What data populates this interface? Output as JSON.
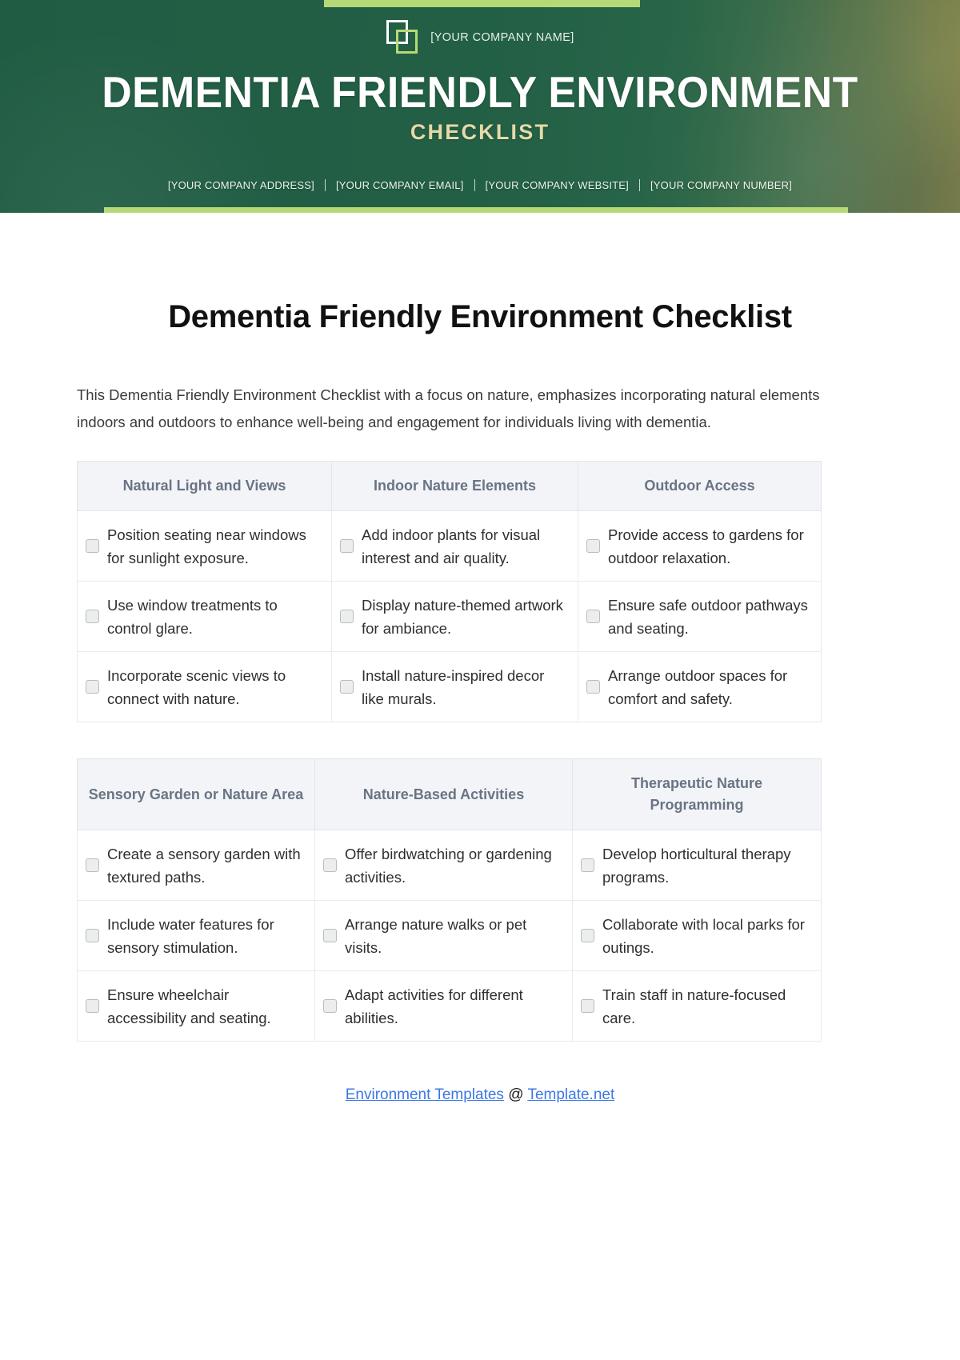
{
  "header": {
    "company_name": "[YOUR COMPANY NAME]",
    "title": "DEMENTIA FRIENDLY ENVIRONMENT",
    "subtitle": "CHECKLIST",
    "contacts": [
      "[YOUR COMPANY ADDRESS]",
      "[YOUR COMPANY EMAIL]",
      "[YOUR COMPANY WEBSITE]",
      "[YOUR COMPANY NUMBER]"
    ],
    "logo_icon": "overlapping-squares-logo",
    "accent_color": "#b6d977",
    "bg_color": "#2b6a4b",
    "subtitle_color": "#e6d9a8"
  },
  "document": {
    "title": "Dementia Friendly Environment Checklist",
    "intro": "This Dementia Friendly Environment Checklist with a focus on nature, emphasizes incorporating natural elements indoors and outdoors to enhance well-being and engagement for individuals living with dementia."
  },
  "tables": [
    {
      "columns": [
        {
          "header": "Natural Light and Views",
          "items": [
            "Position seating near windows for sunlight exposure.",
            "Use window treatments to control glare.",
            "Incorporate scenic views to connect with nature."
          ]
        },
        {
          "header": "Indoor Nature Elements",
          "items": [
            "Add indoor plants for visual interest and air quality.",
            "Display nature-themed artwork for ambiance.",
            "Install nature-inspired decor like murals."
          ]
        },
        {
          "header": "Outdoor Access",
          "items": [
            "Provide access to gardens for outdoor relaxation.",
            "Ensure safe outdoor pathways and seating.",
            "Arrange outdoor spaces for comfort and safety."
          ]
        }
      ]
    },
    {
      "columns": [
        {
          "header": "Sensory Garden or Nature Area",
          "items": [
            "Create a sensory garden with textured paths.",
            "Include water features for sensory stimulation.",
            "Ensure wheelchair accessibility and seating."
          ]
        },
        {
          "header": "Nature-Based Activities",
          "items": [
            "Offer birdwatching or gardening activities.",
            "Arrange nature walks or pet visits.",
            "Adapt activities for different abilities."
          ]
        },
        {
          "header": "Therapeutic Nature Programming",
          "items": [
            "Develop horticultural therapy programs.",
            "Collaborate with local parks for outings.",
            "Train staff in nature-focused care."
          ]
        }
      ]
    }
  ],
  "footer": {
    "link_primary": "Environment Templates",
    "separator": "@",
    "link_secondary": "Template.net"
  }
}
